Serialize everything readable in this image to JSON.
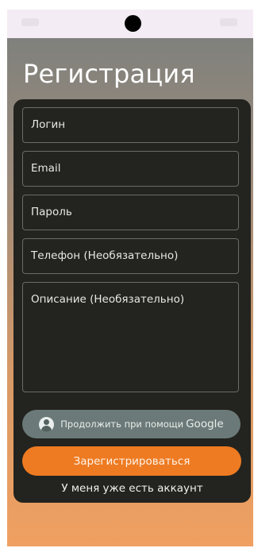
{
  "screen": {
    "title": "Регистрация"
  },
  "form": {
    "fields": [
      {
        "placeholder": "Логин"
      },
      {
        "placeholder": "Email"
      },
      {
        "placeholder": "Пароль"
      },
      {
        "placeholder": "Телефон (Необязательно)"
      },
      {
        "placeholder": "Описание (Необязательно)"
      }
    ],
    "google_button": {
      "text": "Продолжить при помощи",
      "brand": "Google",
      "icon": "account-circle-icon"
    },
    "register_button": "Зарегистрироваться",
    "login_link": "У меня уже есть аккаунт"
  },
  "colors": {
    "accent": "#ee7b22",
    "card": "#23231f",
    "google_button": "#6b7a78"
  }
}
